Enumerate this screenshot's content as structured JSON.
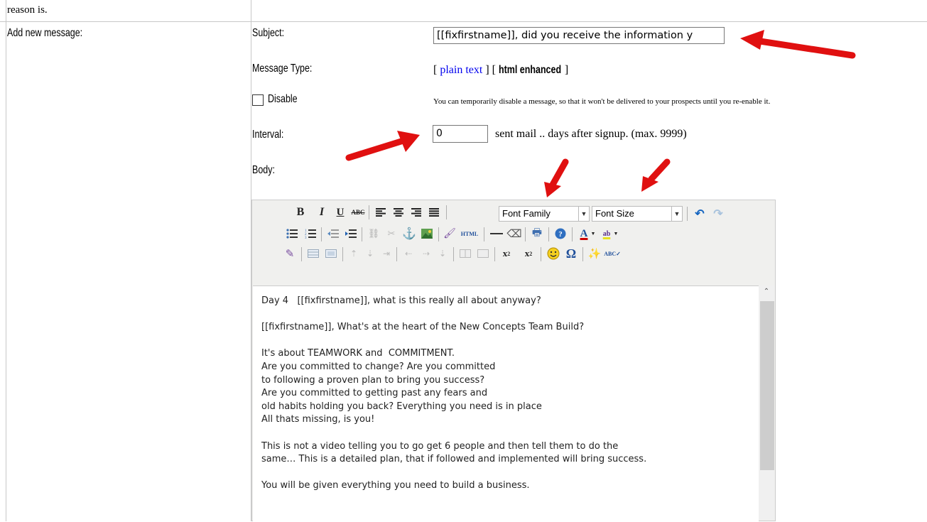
{
  "top_text": "reason is.",
  "row_label": "Add new message:",
  "subject": {
    "label": "Subject:",
    "value": "[[fixfirstname]], did you receive the information y"
  },
  "message_type": {
    "label": "Message Type:",
    "open1": "[ ",
    "plain": "plain text",
    "mid": " ] [ ",
    "html": "html enhanced",
    "close": " ]"
  },
  "disable": {
    "label": "Disable",
    "note": "You can temporarily disable a message, so that it won't be delivered to your prospects until you re-enable it."
  },
  "interval": {
    "label": "Interval:",
    "value": "0",
    "suffix": "sent mail .. days after signup. (max. 9999)"
  },
  "body": {
    "label": "Body:"
  },
  "toolbar": {
    "font_family": "Font Family",
    "font_size": "Font Size",
    "html_label": "HTML"
  },
  "editor_lines": [
    "Day 4   [[fixfirstname]], what is this really all about anyway?",
    "",
    "[[fixfirstname]], What's at the heart of the New Concepts Team Build?",
    "",
    "It's about TEAMWORK and  COMMITMENT.",
    "Are you committed to change? Are you committed",
    "to following a proven plan to bring you success?",
    "Are you committed to getting past any fears and",
    "old habits holding you back? Everything you need is in place",
    "All thats missing, is you!",
    "",
    "This is not a video telling you to go get 6 people and then tell them to do the",
    "same… This is a detailed plan, that if followed and implemented will bring success.",
    "",
    "You will be given everything you need to build a business."
  ],
  "colors": {
    "link": "#0000ee",
    "arrow": "#e01010",
    "border": "#c8c8c8"
  }
}
